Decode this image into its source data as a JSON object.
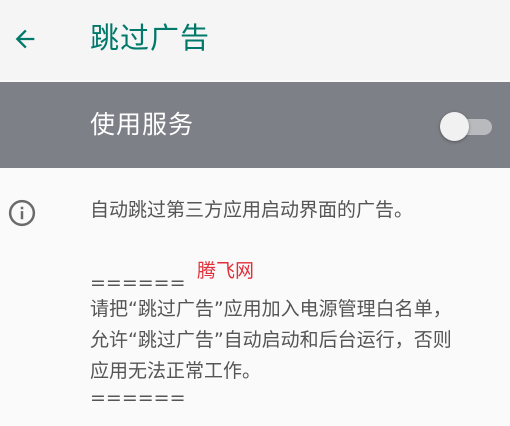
{
  "appbar": {
    "title": "跳过广告",
    "back_icon": "arrow-left-icon",
    "accent_color": "#00796b"
  },
  "service_switch": {
    "label": "使用服务",
    "enabled": false,
    "bar_color": "#7d8087"
  },
  "content": {
    "info_icon": "info-icon",
    "description": "自动跳过第三方应用启动界面的广告。",
    "watermark": "腾飞网",
    "note_lines": [
      "======",
      "请把“跳过广告”应用加入电源管理白名单，",
      "允许“跳过广告”自动启动和后台运行，否则",
      "应用无法正常工作。",
      "======"
    ]
  }
}
